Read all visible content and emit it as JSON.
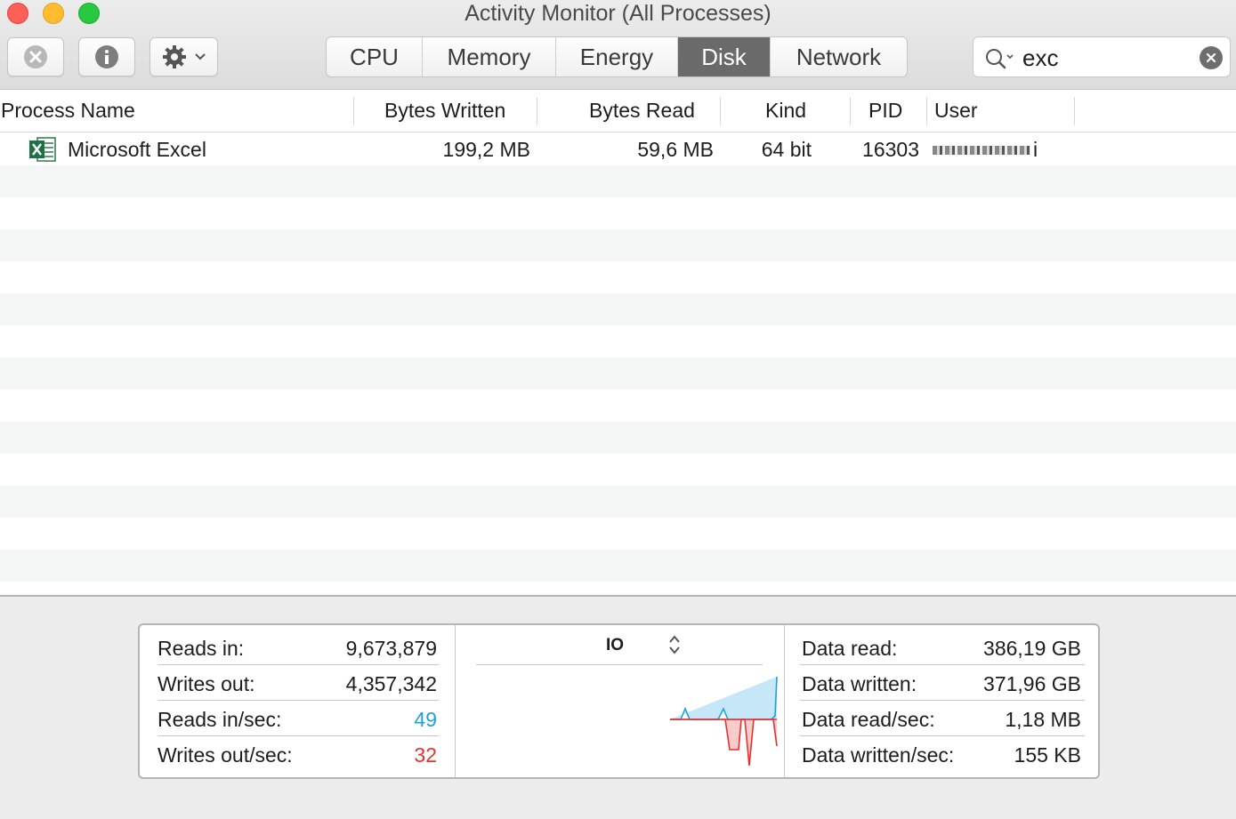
{
  "window": {
    "title": "Activity Monitor (All Processes)"
  },
  "toolbar": {
    "stop_icon": "stop-process-icon",
    "info_icon": "info-icon",
    "gear_icon": "gear-icon"
  },
  "tabs": [
    {
      "label": "CPU",
      "active": false
    },
    {
      "label": "Memory",
      "active": false
    },
    {
      "label": "Energy",
      "active": false
    },
    {
      "label": "Disk",
      "active": true
    },
    {
      "label": "Network",
      "active": false
    }
  ],
  "search": {
    "value": "exc"
  },
  "table": {
    "columns": [
      "Process Name",
      "Bytes Written",
      "Bytes Read",
      "Kind",
      "PID",
      "User"
    ],
    "rows": [
      {
        "icon": "excel-icon",
        "process_name": "Microsoft Excel",
        "bytes_written": "199,2 MB",
        "bytes_read": "59,6 MB",
        "kind": "64 bit",
        "pid": "16303",
        "user": "i"
      }
    ]
  },
  "footer": {
    "left": [
      {
        "label": "Reads in:",
        "value": "9,673,879",
        "color": "#1d1d1d"
      },
      {
        "label": "Writes out:",
        "value": "4,357,342",
        "color": "#1d1d1d"
      },
      {
        "label": "Reads in/sec:",
        "value": "49",
        "color": "#1ba1e2"
      },
      {
        "label": "Writes out/sec:",
        "value": "32",
        "color": "#e8312f"
      }
    ],
    "graph": {
      "label": "IO",
      "read_color": "#1ba1e2",
      "write_color": "#e8312f"
    },
    "right": [
      {
        "label": "Data read:",
        "value": "386,19 GB"
      },
      {
        "label": "Data written:",
        "value": "371,96 GB"
      },
      {
        "label": "Data read/sec:",
        "value": "1,18 MB"
      },
      {
        "label": "Data written/sec:",
        "value": "155 KB"
      }
    ]
  }
}
